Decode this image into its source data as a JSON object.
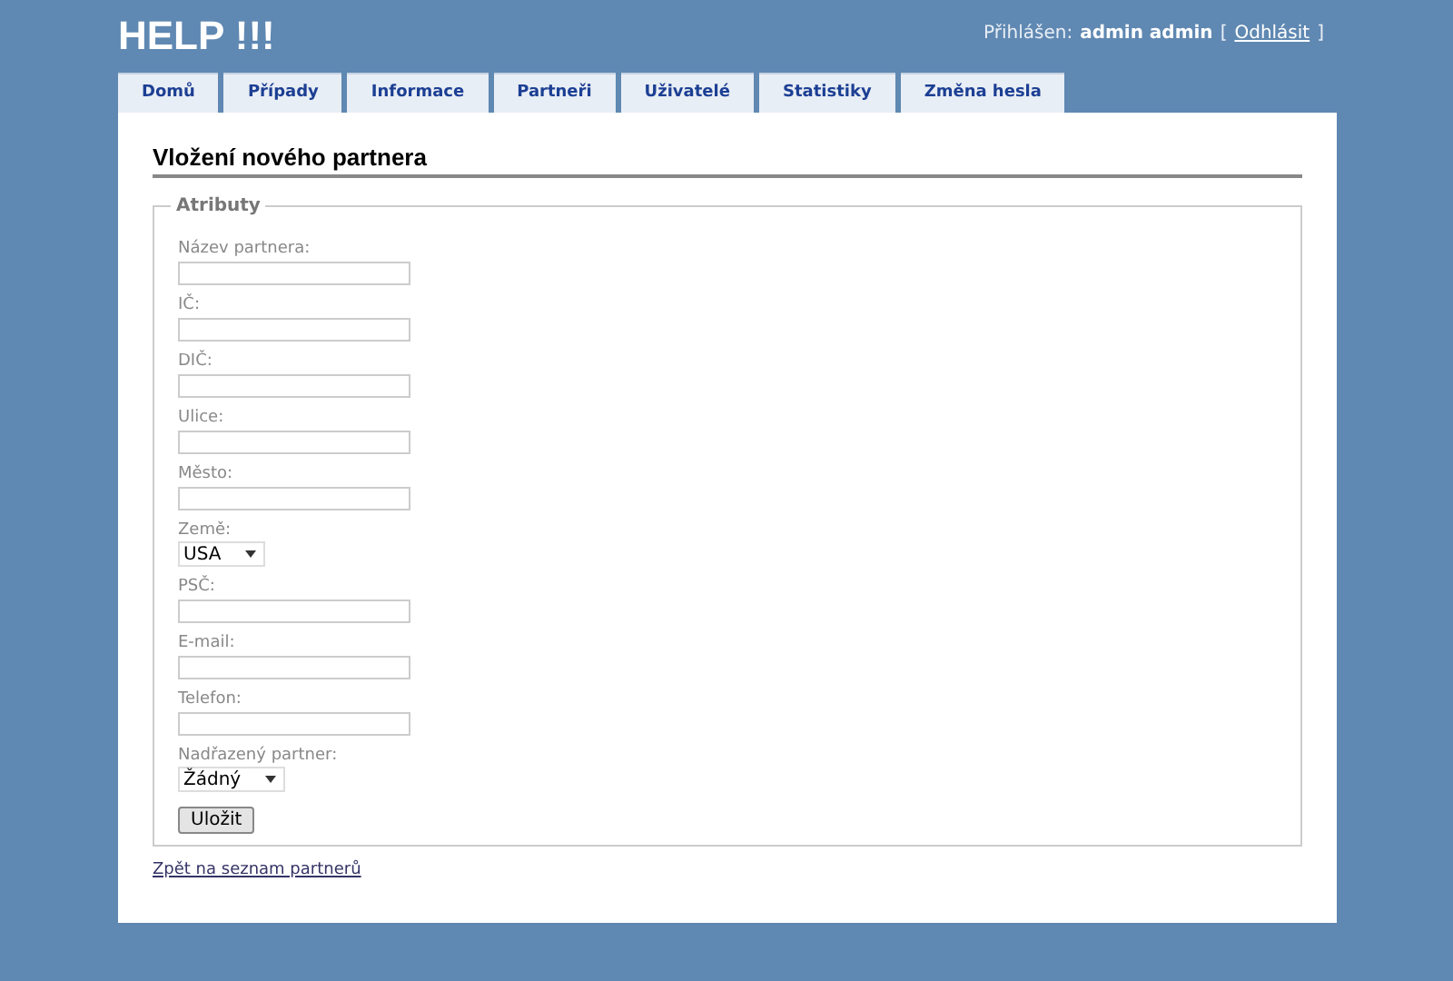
{
  "app_title": "HELP !!!",
  "user": {
    "label": "Přihlášen:",
    "name": "admin admin",
    "open_bracket": "[",
    "logout": "Odhlásit",
    "close_bracket": "]"
  },
  "tabs": [
    {
      "label": "Domů"
    },
    {
      "label": "Případy"
    },
    {
      "label": "Informace"
    },
    {
      "label": "Partneři"
    },
    {
      "label": "Uživatelé"
    },
    {
      "label": "Statistiky"
    },
    {
      "label": "Změna hesla"
    }
  ],
  "heading": "Vložení nového partnera",
  "fieldset": {
    "legend": "Atributy",
    "fields": [
      {
        "kind": "text",
        "label": "Název partnera:"
      },
      {
        "kind": "text",
        "label": "IČ:"
      },
      {
        "kind": "text",
        "label": "DIČ:"
      },
      {
        "kind": "text",
        "label": "Ulice:"
      },
      {
        "kind": "text",
        "label": "Město:"
      },
      {
        "kind": "select",
        "label": "Země:",
        "value": "USA"
      },
      {
        "kind": "text",
        "label": "PSČ:"
      },
      {
        "kind": "text",
        "label": "E-mail:"
      },
      {
        "kind": "text",
        "label": "Telefon:"
      },
      {
        "kind": "select",
        "label": "Nadřazený partner:",
        "value": "Žádný"
      }
    ],
    "submit": "Uložit"
  },
  "back_link": "Zpět na seznam partnerů"
}
